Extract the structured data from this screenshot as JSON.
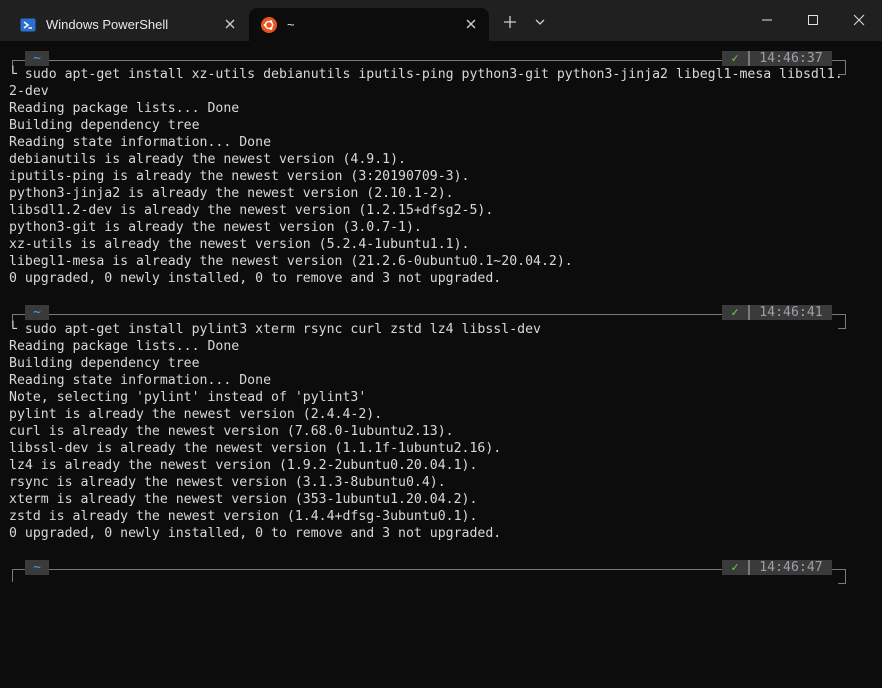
{
  "window": {
    "tabs": [
      {
        "label": "Windows PowerShell",
        "icon": "powershell-icon",
        "active": false
      },
      {
        "label": "~",
        "icon": "ubuntu-icon",
        "active": true
      }
    ],
    "new_tab_label": "+",
    "dropdown_icon": "chevron-down-icon",
    "controls": [
      "minimize-icon",
      "maximize-icon",
      "close-icon"
    ]
  },
  "colors": {
    "background": "#0c0c0c",
    "titlebar": "#202020",
    "prompt_tilde": "#3aa0ff",
    "prompt_check": "#6ddc2f",
    "text": "#d8d8d8"
  },
  "prompts": [
    {
      "dir": "~",
      "status": "✓",
      "time": "14:46:37"
    },
    {
      "dir": "~",
      "status": "✓",
      "time": "14:46:41"
    },
    {
      "dir": "~",
      "status": "✓",
      "time": "14:46:47"
    }
  ],
  "block1": [
    "└ sudo apt-get install xz-utils debianutils iputils-ping python3-git python3-jinja2 libegl1-mesa libsdl1.",
    "2-dev",
    "Reading package lists... Done",
    "Building dependency tree",
    "Reading state information... Done",
    "debianutils is already the newest version (4.9.1).",
    "iputils-ping is already the newest version (3:20190709-3).",
    "python3-jinja2 is already the newest version (2.10.1-2).",
    "libsdl1.2-dev is already the newest version (1.2.15+dfsg2-5).",
    "python3-git is already the newest version (3.0.7-1).",
    "xz-utils is already the newest version (5.2.4-1ubuntu1.1).",
    "libegl1-mesa is already the newest version (21.2.6-0ubuntu0.1~20.04.2).",
    "0 upgraded, 0 newly installed, 0 to remove and 3 not upgraded."
  ],
  "block2": [
    "└ sudo apt-get install pylint3 xterm rsync curl zstd lz4 libssl-dev",
    "Reading package lists... Done",
    "Building dependency tree",
    "Reading state information... Done",
    "Note, selecting 'pylint' instead of 'pylint3'",
    "pylint is already the newest version (2.4.4-2).",
    "curl is already the newest version (7.68.0-1ubuntu2.13).",
    "libssl-dev is already the newest version (1.1.1f-1ubuntu2.16).",
    "lz4 is already the newest version (1.9.2-2ubuntu0.20.04.1).",
    "rsync is already the newest version (3.1.3-8ubuntu0.4).",
    "xterm is already the newest version (353-1ubuntu1.20.04.2).",
    "zstd is already the newest version (1.4.4+dfsg-3ubuntu0.1).",
    "0 upgraded, 0 newly installed, 0 to remove and 3 not upgraded."
  ]
}
